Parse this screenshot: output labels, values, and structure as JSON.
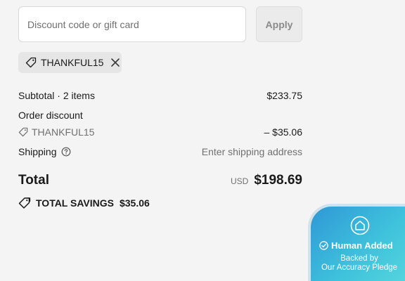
{
  "discount": {
    "placeholder": "Discount code or gift card",
    "apply_label": "Apply"
  },
  "applied_code": {
    "code": "THANKFUL15",
    "tag_icon": "tag-icon",
    "remove_icon": "close-icon"
  },
  "summary": {
    "subtotal_label": "Subtotal · 2 items",
    "subtotal_value": "$233.75",
    "order_discount_label": "Order discount",
    "discount_code": "THANKFUL15",
    "discount_value": "– $35.06",
    "shipping_label": "Shipping",
    "shipping_value": "Enter shipping address"
  },
  "total": {
    "label": "Total",
    "currency": "USD",
    "amount": "$198.69"
  },
  "savings": {
    "label": "TOTAL SAVINGS",
    "amount": "$35.06"
  },
  "badge": {
    "title": "Human Added",
    "line1": "Backed by",
    "line2": "Our Accuracy Pledge"
  },
  "colors": {
    "background": "#f4f4f4",
    "badge_gradient_start": "#2f98d6",
    "badge_gradient_end": "#5ad8de"
  }
}
